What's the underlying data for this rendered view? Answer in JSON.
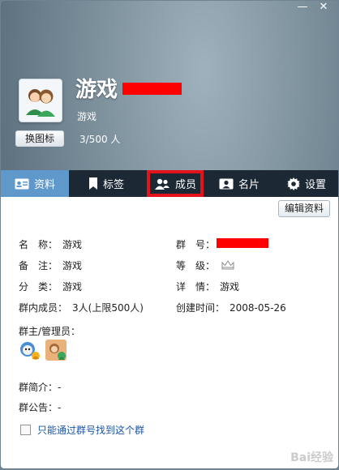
{
  "window": {
    "minimize": "—",
    "close": "✕"
  },
  "header": {
    "group_name": "游戏",
    "subtitle": "游戏",
    "change_icon_label": "换图标",
    "member_count": "3/500 人"
  },
  "tabs": [
    {
      "label": "资料",
      "icon": "profile-card-icon"
    },
    {
      "label": "标签",
      "icon": "bookmark-icon"
    },
    {
      "label": "成员",
      "icon": "members-icon"
    },
    {
      "label": "名片",
      "icon": "business-card-icon"
    },
    {
      "label": "设置",
      "icon": "gear-icon"
    }
  ],
  "content": {
    "edit_button": "编辑资料",
    "fields": {
      "name_label": "名　称：",
      "name_value": "游戏",
      "remark_label": "备　注：",
      "remark_value": "游戏",
      "category_label": "分　类：",
      "category_value": "游戏",
      "members_label": "群内成员：",
      "members_value": "3人(上限500人)",
      "number_label": "群　号：",
      "level_label": "等　级：",
      "level_icon": "crown-icon",
      "details_label": "详　情：",
      "details_value": "游戏",
      "created_label": "创建时间：",
      "created_value": "2008-05-26"
    },
    "admins_label": "群主/管理员：",
    "intro_label": "群简介：-",
    "notice_label": "群公告：-",
    "checkbox_label": "只能通过群号找到这个群"
  },
  "watermark": "Bai经验",
  "colors": {
    "active_tab": "#5f99cc",
    "tabbar": "#1c2935",
    "highlight": "#e4131b",
    "link": "#1a55a5"
  }
}
